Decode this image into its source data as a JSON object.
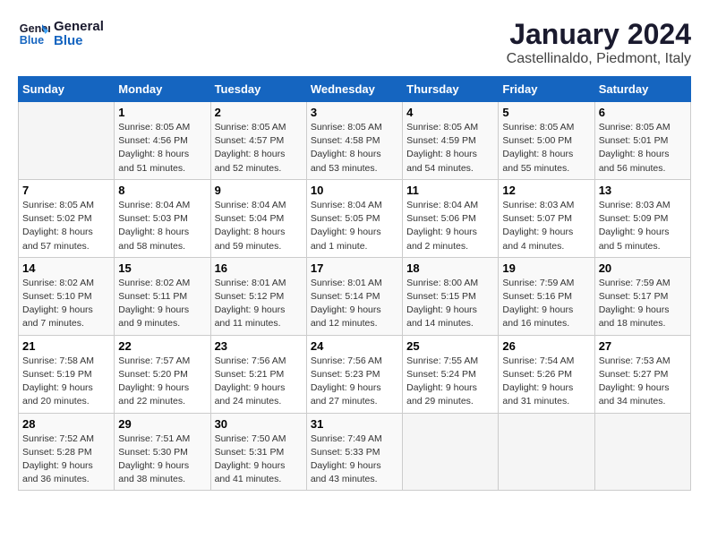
{
  "header": {
    "logo_line1": "General",
    "logo_line2": "Blue",
    "title": "January 2024",
    "subtitle": "Castellinaldo, Piedmont, Italy"
  },
  "weekdays": [
    "Sunday",
    "Monday",
    "Tuesday",
    "Wednesday",
    "Thursday",
    "Friday",
    "Saturday"
  ],
  "weeks": [
    [
      {
        "num": "",
        "sunrise": "",
        "sunset": "",
        "daylight": ""
      },
      {
        "num": "1",
        "sunrise": "Sunrise: 8:05 AM",
        "sunset": "Sunset: 4:56 PM",
        "daylight": "Daylight: 8 hours and 51 minutes."
      },
      {
        "num": "2",
        "sunrise": "Sunrise: 8:05 AM",
        "sunset": "Sunset: 4:57 PM",
        "daylight": "Daylight: 8 hours and 52 minutes."
      },
      {
        "num": "3",
        "sunrise": "Sunrise: 8:05 AM",
        "sunset": "Sunset: 4:58 PM",
        "daylight": "Daylight: 8 hours and 53 minutes."
      },
      {
        "num": "4",
        "sunrise": "Sunrise: 8:05 AM",
        "sunset": "Sunset: 4:59 PM",
        "daylight": "Daylight: 8 hours and 54 minutes."
      },
      {
        "num": "5",
        "sunrise": "Sunrise: 8:05 AM",
        "sunset": "Sunset: 5:00 PM",
        "daylight": "Daylight: 8 hours and 55 minutes."
      },
      {
        "num": "6",
        "sunrise": "Sunrise: 8:05 AM",
        "sunset": "Sunset: 5:01 PM",
        "daylight": "Daylight: 8 hours and 56 minutes."
      }
    ],
    [
      {
        "num": "7",
        "sunrise": "Sunrise: 8:05 AM",
        "sunset": "Sunset: 5:02 PM",
        "daylight": "Daylight: 8 hours and 57 minutes."
      },
      {
        "num": "8",
        "sunrise": "Sunrise: 8:04 AM",
        "sunset": "Sunset: 5:03 PM",
        "daylight": "Daylight: 8 hours and 58 minutes."
      },
      {
        "num": "9",
        "sunrise": "Sunrise: 8:04 AM",
        "sunset": "Sunset: 5:04 PM",
        "daylight": "Daylight: 8 hours and 59 minutes."
      },
      {
        "num": "10",
        "sunrise": "Sunrise: 8:04 AM",
        "sunset": "Sunset: 5:05 PM",
        "daylight": "Daylight: 9 hours and 1 minute."
      },
      {
        "num": "11",
        "sunrise": "Sunrise: 8:04 AM",
        "sunset": "Sunset: 5:06 PM",
        "daylight": "Daylight: 9 hours and 2 minutes."
      },
      {
        "num": "12",
        "sunrise": "Sunrise: 8:03 AM",
        "sunset": "Sunset: 5:07 PM",
        "daylight": "Daylight: 9 hours and 4 minutes."
      },
      {
        "num": "13",
        "sunrise": "Sunrise: 8:03 AM",
        "sunset": "Sunset: 5:09 PM",
        "daylight": "Daylight: 9 hours and 5 minutes."
      }
    ],
    [
      {
        "num": "14",
        "sunrise": "Sunrise: 8:02 AM",
        "sunset": "Sunset: 5:10 PM",
        "daylight": "Daylight: 9 hours and 7 minutes."
      },
      {
        "num": "15",
        "sunrise": "Sunrise: 8:02 AM",
        "sunset": "Sunset: 5:11 PM",
        "daylight": "Daylight: 9 hours and 9 minutes."
      },
      {
        "num": "16",
        "sunrise": "Sunrise: 8:01 AM",
        "sunset": "Sunset: 5:12 PM",
        "daylight": "Daylight: 9 hours and 11 minutes."
      },
      {
        "num": "17",
        "sunrise": "Sunrise: 8:01 AM",
        "sunset": "Sunset: 5:14 PM",
        "daylight": "Daylight: 9 hours and 12 minutes."
      },
      {
        "num": "18",
        "sunrise": "Sunrise: 8:00 AM",
        "sunset": "Sunset: 5:15 PM",
        "daylight": "Daylight: 9 hours and 14 minutes."
      },
      {
        "num": "19",
        "sunrise": "Sunrise: 7:59 AM",
        "sunset": "Sunset: 5:16 PM",
        "daylight": "Daylight: 9 hours and 16 minutes."
      },
      {
        "num": "20",
        "sunrise": "Sunrise: 7:59 AM",
        "sunset": "Sunset: 5:17 PM",
        "daylight": "Daylight: 9 hours and 18 minutes."
      }
    ],
    [
      {
        "num": "21",
        "sunrise": "Sunrise: 7:58 AM",
        "sunset": "Sunset: 5:19 PM",
        "daylight": "Daylight: 9 hours and 20 minutes."
      },
      {
        "num": "22",
        "sunrise": "Sunrise: 7:57 AM",
        "sunset": "Sunset: 5:20 PM",
        "daylight": "Daylight: 9 hours and 22 minutes."
      },
      {
        "num": "23",
        "sunrise": "Sunrise: 7:56 AM",
        "sunset": "Sunset: 5:21 PM",
        "daylight": "Daylight: 9 hours and 24 minutes."
      },
      {
        "num": "24",
        "sunrise": "Sunrise: 7:56 AM",
        "sunset": "Sunset: 5:23 PM",
        "daylight": "Daylight: 9 hours and 27 minutes."
      },
      {
        "num": "25",
        "sunrise": "Sunrise: 7:55 AM",
        "sunset": "Sunset: 5:24 PM",
        "daylight": "Daylight: 9 hours and 29 minutes."
      },
      {
        "num": "26",
        "sunrise": "Sunrise: 7:54 AM",
        "sunset": "Sunset: 5:26 PM",
        "daylight": "Daylight: 9 hours and 31 minutes."
      },
      {
        "num": "27",
        "sunrise": "Sunrise: 7:53 AM",
        "sunset": "Sunset: 5:27 PM",
        "daylight": "Daylight: 9 hours and 34 minutes."
      }
    ],
    [
      {
        "num": "28",
        "sunrise": "Sunrise: 7:52 AM",
        "sunset": "Sunset: 5:28 PM",
        "daylight": "Daylight: 9 hours and 36 minutes."
      },
      {
        "num": "29",
        "sunrise": "Sunrise: 7:51 AM",
        "sunset": "Sunset: 5:30 PM",
        "daylight": "Daylight: 9 hours and 38 minutes."
      },
      {
        "num": "30",
        "sunrise": "Sunrise: 7:50 AM",
        "sunset": "Sunset: 5:31 PM",
        "daylight": "Daylight: 9 hours and 41 minutes."
      },
      {
        "num": "31",
        "sunrise": "Sunrise: 7:49 AM",
        "sunset": "Sunset: 5:33 PM",
        "daylight": "Daylight: 9 hours and 43 minutes."
      },
      {
        "num": "",
        "sunrise": "",
        "sunset": "",
        "daylight": ""
      },
      {
        "num": "",
        "sunrise": "",
        "sunset": "",
        "daylight": ""
      },
      {
        "num": "",
        "sunrise": "",
        "sunset": "",
        "daylight": ""
      }
    ]
  ]
}
